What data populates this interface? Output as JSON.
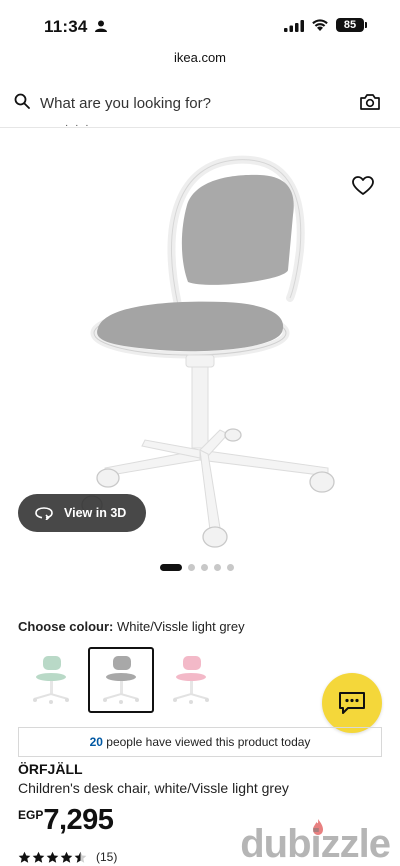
{
  "status_bar": {
    "time": "11:34",
    "battery": "85"
  },
  "browser": {
    "url": "ikea.com"
  },
  "search": {
    "placeholder": "What are you looking for?"
  },
  "product_view": {
    "view_3d_label": "View in 3D",
    "image_pages": 5,
    "active_page": 1
  },
  "colour": {
    "label": "Choose colour:",
    "selected": "White/Vissle light grey"
  },
  "swatches": [
    {
      "name": "green",
      "color": "#b9d9c7"
    },
    {
      "name": "white-grey",
      "color": "#a8a8a8"
    },
    {
      "name": "pink",
      "color": "#f3b9c8"
    }
  ],
  "viewed": {
    "count": "20",
    "text": "people have viewed this product today"
  },
  "product": {
    "name": "ÖRFJÄLL",
    "description": "Children's desk chair, white/Vissle light grey",
    "currency": "EGP",
    "price": "7,295"
  },
  "rating": {
    "stars": 4.5,
    "count": "(15)"
  },
  "watermark": "dubizzle",
  "colors": {
    "ikea_blue": "#0058a3",
    "chat_yellow": "#f4d73a"
  }
}
